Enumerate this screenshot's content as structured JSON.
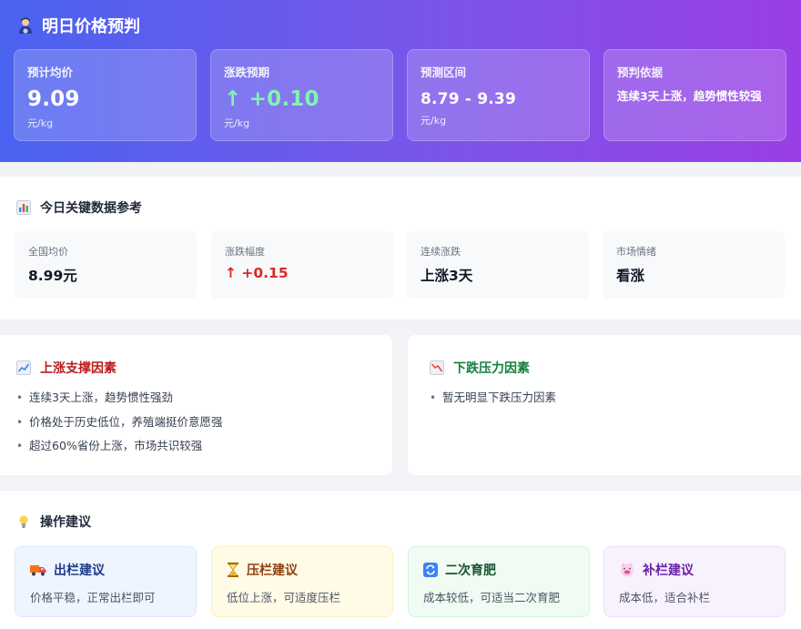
{
  "header": {
    "title": "明日价格预判",
    "cards": [
      {
        "label": "预计均价",
        "value": "9.09",
        "unit": "元/kg"
      },
      {
        "label": "涨跌预期",
        "value": "↑ +0.10",
        "unit": "元/kg"
      },
      {
        "label": "预测区间",
        "value": "8.79 - 9.39",
        "unit": "元/kg"
      },
      {
        "label": "预判依据",
        "value": "连续3天上涨，趋势惯性较强"
      }
    ]
  },
  "today": {
    "title": "今日关键数据参考",
    "stats": [
      {
        "label": "全国均价",
        "value": "8.99元"
      },
      {
        "label": "涨跌幅度",
        "value": "↑ +0.15"
      },
      {
        "label": "连续涨跌",
        "value": "上涨3天"
      },
      {
        "label": "市场情绪",
        "value": "看涨"
      }
    ]
  },
  "up_factors": {
    "title": "上涨支撑因素",
    "items": [
      "连续3天上涨，趋势惯性强劲",
      "价格处于历史低位，养殖端挺价意愿强",
      "超过60%省份上涨，市场共识较强"
    ]
  },
  "down_factors": {
    "title": "下跌压力因素",
    "items": [
      "暂无明显下跌压力因素"
    ]
  },
  "advice": {
    "title": "操作建议",
    "cards": [
      {
        "title": "出栏建议",
        "desc": "价格平稳，正常出栏即可",
        "icon": "truck-icon"
      },
      {
        "title": "压栏建议",
        "desc": "低位上涨，可适度压栏",
        "icon": "hourglass-icon"
      },
      {
        "title": "二次育肥",
        "desc": "成本较低，可适当二次育肥",
        "icon": "cycle-icon"
      },
      {
        "title": "补栏建议",
        "desc": "成本低，适合补栏",
        "icon": "pig-icon"
      }
    ]
  },
  "colors": {
    "up_red": "#dc2626",
    "down_green": "#15803d",
    "header_gradient_start": "#4a63f0",
    "header_gradient_end": "#9a3ee6"
  }
}
